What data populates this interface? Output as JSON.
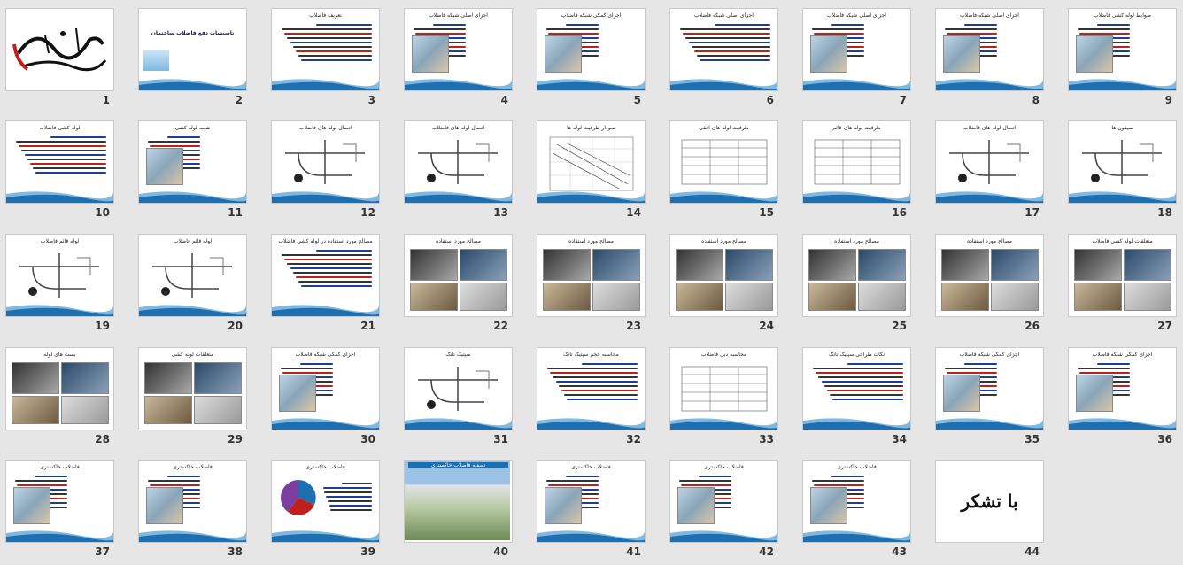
{
  "slides": [
    {
      "n": "1",
      "kind": "calligraphy",
      "title": "بسم الله الرحمن الرحیم"
    },
    {
      "n": "2",
      "kind": "titleslide",
      "title": "تاسیسات دفع فاضلاب ساختمان"
    },
    {
      "n": "3",
      "kind": "text",
      "title": "تعریف فاضلاب"
    },
    {
      "n": "4",
      "kind": "textpic",
      "title": "اجزای اصلی شبکه فاضلاب"
    },
    {
      "n": "5",
      "kind": "textpic",
      "title": "اجزای کمکی شبکه فاضلاب"
    },
    {
      "n": "6",
      "kind": "text",
      "title": "اجزای اصلی شبکه فاضلاب"
    },
    {
      "n": "7",
      "kind": "textpic",
      "title": "اجزای اصلی شبکه فاضلاب"
    },
    {
      "n": "8",
      "kind": "textpic",
      "title": "اجزای اصلی شبکه فاضلاب"
    },
    {
      "n": "9",
      "kind": "textpic",
      "title": "ضوابط لوله کشی فاضلاب"
    },
    {
      "n": "10",
      "kind": "text",
      "title": "لوله کشی فاضلاب"
    },
    {
      "n": "11",
      "kind": "textpic",
      "title": "شیب لوله کشی"
    },
    {
      "n": "12",
      "kind": "diagram",
      "title": "اتصال لوله های فاضلاب"
    },
    {
      "n": "13",
      "kind": "diagram",
      "title": "اتصال لوله های فاضلاب"
    },
    {
      "n": "14",
      "kind": "chart",
      "title": "نمودار ظرفیت لوله ها"
    },
    {
      "n": "15",
      "kind": "table",
      "title": "ظرفیت لوله های افقی"
    },
    {
      "n": "16",
      "kind": "table",
      "title": "ظرفیت لوله های قائم"
    },
    {
      "n": "17",
      "kind": "diagram",
      "title": "اتصال لوله های فاضلاب"
    },
    {
      "n": "18",
      "kind": "diagram",
      "title": "سیفون ها"
    },
    {
      "n": "19",
      "kind": "diagram",
      "title": "لوله قائم فاضلاب"
    },
    {
      "n": "20",
      "kind": "diagram",
      "title": "لوله قائم فاضلاب"
    },
    {
      "n": "21",
      "kind": "text",
      "title": "مصالح مورد استفاده در لوله کشی فاضلاب"
    },
    {
      "n": "22",
      "kind": "photos",
      "title": "مصالح مورد استفاده"
    },
    {
      "n": "23",
      "kind": "photos",
      "title": "مصالح مورد استفاده"
    },
    {
      "n": "24",
      "kind": "photos",
      "title": "مصالح مورد استفاده"
    },
    {
      "n": "25",
      "kind": "photos",
      "title": "مصالح مورد استفاده"
    },
    {
      "n": "26",
      "kind": "photos",
      "title": "مصالح مورد استفاده"
    },
    {
      "n": "27",
      "kind": "photos",
      "title": "متعلقات لوله کشی فاضلاب"
    },
    {
      "n": "28",
      "kind": "photos",
      "title": "بست های لوله"
    },
    {
      "n": "29",
      "kind": "photos",
      "title": "متعلقات لوله کشی"
    },
    {
      "n": "30",
      "kind": "textpic",
      "title": "اجزای کمکی شبکه فاضلاب"
    },
    {
      "n": "31",
      "kind": "diagram",
      "title": "سپتیک تانک"
    },
    {
      "n": "32",
      "kind": "text",
      "title": "محاسبه حجم سپتیک تانک"
    },
    {
      "n": "33",
      "kind": "table",
      "title": "محاسبه دبی فاضلاب"
    },
    {
      "n": "34",
      "kind": "text",
      "title": "نکات طراحی سپتیک تانک"
    },
    {
      "n": "35",
      "kind": "textpic",
      "title": "اجزای کمکی شبکه فاضلاب"
    },
    {
      "n": "36",
      "kind": "textpic",
      "title": "اجزای کمکی شبکه فاضلاب"
    },
    {
      "n": "37",
      "kind": "textpic",
      "title": "فاضلاب خاکستری"
    },
    {
      "n": "38",
      "kind": "textpic",
      "title": "فاضلاب خاکستری"
    },
    {
      "n": "39",
      "kind": "pie",
      "title": "فاضلاب خاکستری"
    },
    {
      "n": "40",
      "kind": "photo",
      "title": "تصفیه فاضلاب خاکستری"
    },
    {
      "n": "41",
      "kind": "textpic",
      "title": "فاضلاب خاکستری"
    },
    {
      "n": "42",
      "kind": "textpic",
      "title": "فاضلاب خاکستری"
    },
    {
      "n": "43",
      "kind": "textpic",
      "title": "فاضلاب خاکستری"
    },
    {
      "n": "44",
      "kind": "thanks",
      "title": "با تشکر"
    }
  ],
  "colors": {
    "accent": "#1e6fb0",
    "wave_light": "#7fb8e0",
    "red_text": "#c0201a",
    "blue_text": "#1a3f9a"
  }
}
